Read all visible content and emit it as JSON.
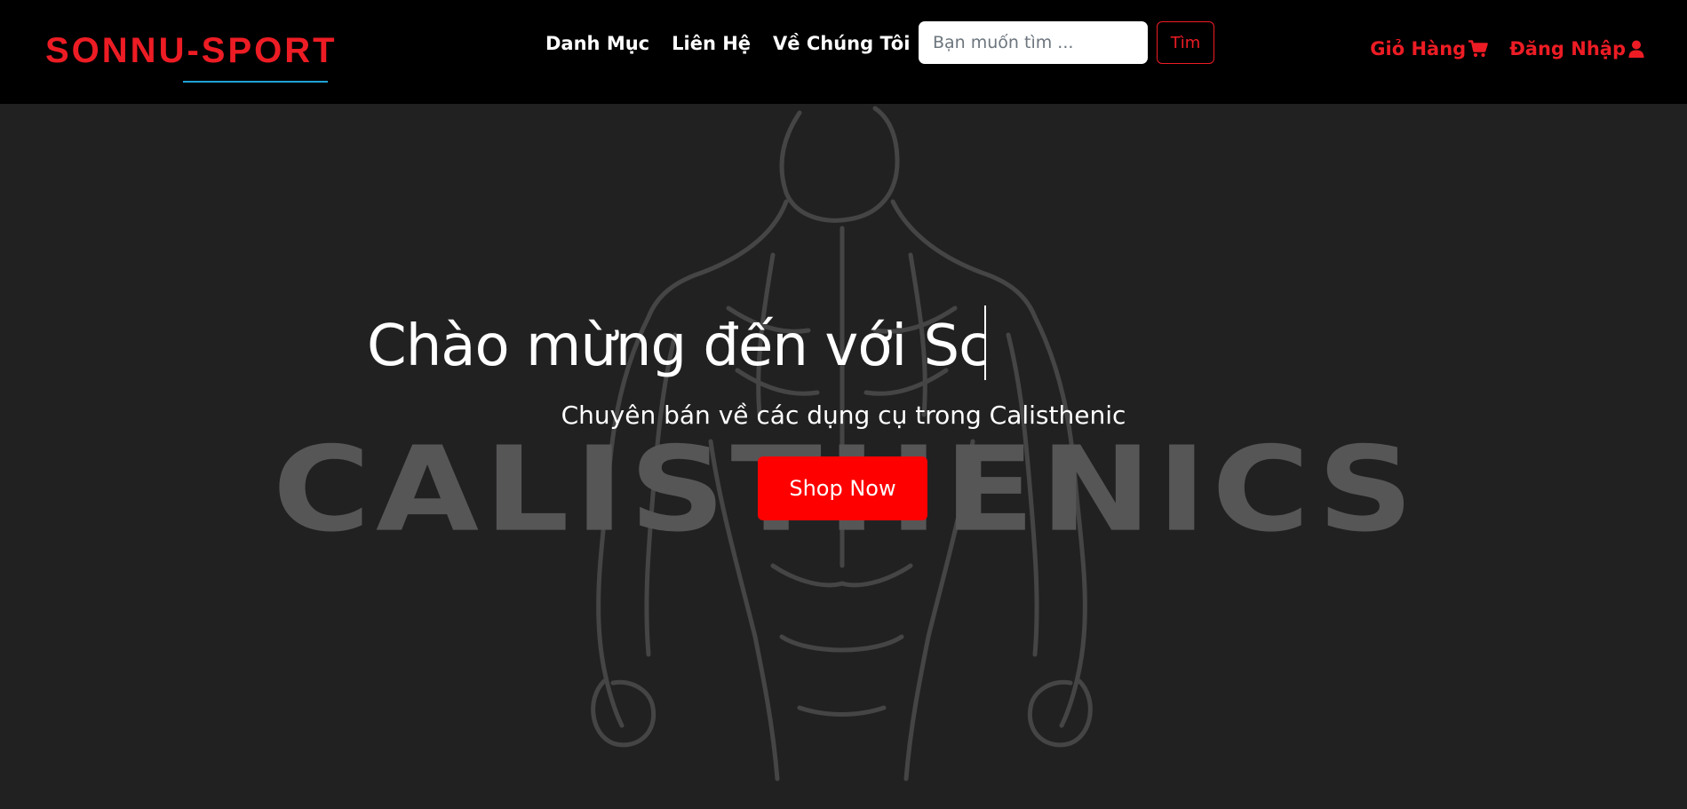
{
  "header": {
    "brand": "SONNU-SPORT",
    "nav_links": [
      "Danh Mục",
      "Liên Hệ",
      "Về Chúng Tôi"
    ],
    "search": {
      "placeholder": "Bạn muốn tìm ...",
      "value": "",
      "button_label": "Tìm"
    },
    "cart": {
      "label": "Giỏ Hàng",
      "icon": "shopping-cart-icon"
    },
    "login": {
      "label": "Đăng Nhập",
      "icon": "user-icon"
    }
  },
  "hero": {
    "background_word": "CALISTHENICS",
    "title_typed": "Chào mừng đến với Sc",
    "subtitle": "Chuyên bán về các dụng cụ trong Calisthenic",
    "cta_label": "Shop Now"
  },
  "colors": {
    "brand_red": "#ed1c24",
    "cta_red": "#ff0000",
    "navbar_bg": "#000000",
    "hero_bg": "#222122",
    "brand_underline": "#1fa2d6"
  }
}
